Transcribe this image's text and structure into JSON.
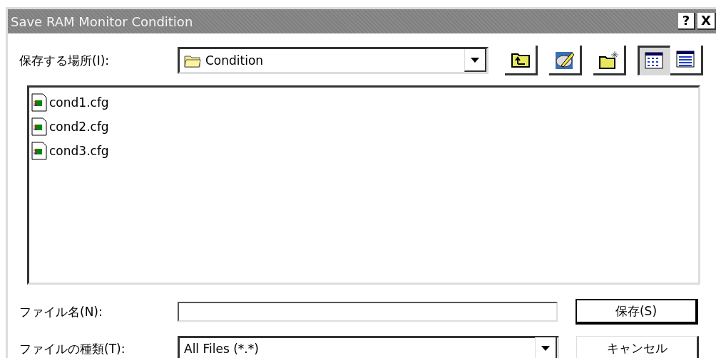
{
  "window": {
    "title": "Save RAM Monitor Condition",
    "title_buttons": [
      {
        "kind": "help",
        "label": "?"
      },
      {
        "kind": "close",
        "label": "X"
      }
    ]
  },
  "location": {
    "label": "保存する場所(I):",
    "value": "Condition"
  },
  "toolbar": [
    {
      "kind": "up",
      "selected": false
    },
    {
      "kind": "drive",
      "selected": false
    },
    {
      "kind": "newfolder",
      "selected": false
    },
    {
      "kind": "list",
      "selected": true
    },
    {
      "kind": "details",
      "selected": false
    }
  ],
  "files": [
    {
      "name": "cond1.cfg"
    },
    {
      "name": "cond2.cfg"
    },
    {
      "name": "cond3.cfg"
    }
  ],
  "filename": {
    "label": "ファイル名(N):"
  },
  "filetype": {
    "label": "ファイルの種類(T):",
    "value": "All Files (*.*)"
  },
  "buttons": [
    {
      "label": "保存(S)",
      "default": true
    },
    {
      "label": "キャンセル",
      "default": false
    }
  ]
}
